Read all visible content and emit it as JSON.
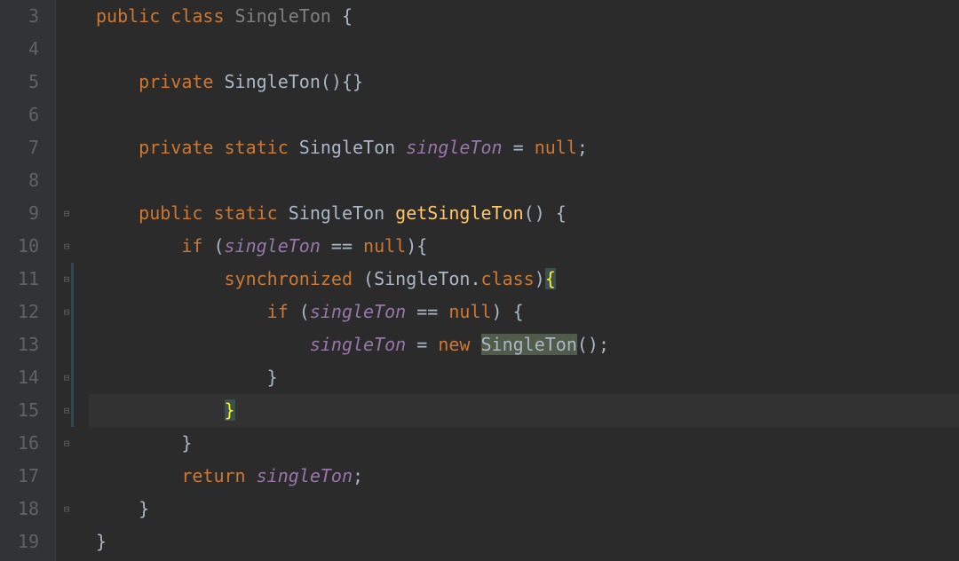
{
  "editor": {
    "startLine": 3,
    "lineNumbers": [
      "3",
      "4",
      "5",
      "6",
      "7",
      "8",
      "9",
      "10",
      "11",
      "12",
      "13",
      "14",
      "15",
      "16",
      "17",
      "18",
      "19"
    ],
    "currentLine": 15,
    "lines": [
      {
        "n": 3,
        "indent": 0,
        "fold": null,
        "tokens": [
          {
            "t": "public ",
            "c": "kw"
          },
          {
            "t": "class ",
            "c": "kw"
          },
          {
            "t": "SingleTon ",
            "c": "grey"
          },
          {
            "t": "{",
            "c": "punct"
          }
        ]
      },
      {
        "n": 4,
        "indent": 0,
        "fold": null,
        "tokens": []
      },
      {
        "n": 5,
        "indent": 1,
        "fold": null,
        "tokens": [
          {
            "t": "private ",
            "c": "kw"
          },
          {
            "t": "SingleTon",
            "c": "methoddecl"
          },
          {
            "t": "(){}",
            "c": "punct"
          }
        ]
      },
      {
        "n": 6,
        "indent": 0,
        "fold": null,
        "tokens": []
      },
      {
        "n": 7,
        "indent": 1,
        "fold": null,
        "tokens": [
          {
            "t": "private static ",
            "c": "kw"
          },
          {
            "t": "SingleTon ",
            "c": "punct"
          },
          {
            "t": "singleTon",
            "c": "field"
          },
          {
            "t": " = ",
            "c": "punct"
          },
          {
            "t": "null",
            "c": "kw"
          },
          {
            "t": ";",
            "c": "punct"
          }
        ]
      },
      {
        "n": 8,
        "indent": 0,
        "fold": null,
        "tokens": []
      },
      {
        "n": 9,
        "indent": 1,
        "fold": "open",
        "tokens": [
          {
            "t": "public static ",
            "c": "kw"
          },
          {
            "t": "SingleTon ",
            "c": "punct"
          },
          {
            "t": "getSingleTon",
            "c": "method"
          },
          {
            "t": "() {",
            "c": "punct"
          }
        ]
      },
      {
        "n": 10,
        "indent": 2,
        "fold": "open",
        "tokens": [
          {
            "t": "if ",
            "c": "kw"
          },
          {
            "t": "(",
            "c": "punct"
          },
          {
            "t": "singleTon",
            "c": "field"
          },
          {
            "t": " == ",
            "c": "punct"
          },
          {
            "t": "null",
            "c": "kw"
          },
          {
            "t": "){",
            "c": "punct"
          }
        ]
      },
      {
        "n": 11,
        "indent": 3,
        "fold": "open",
        "tokens": [
          {
            "t": "synchronized ",
            "c": "kw"
          },
          {
            "t": "(SingleTon.",
            "c": "punct"
          },
          {
            "t": "class",
            "c": "kw"
          },
          {
            "t": ")",
            "c": "punct"
          },
          {
            "t": "{",
            "c": "brace-match"
          }
        ]
      },
      {
        "n": 12,
        "indent": 4,
        "fold": "open",
        "tokens": [
          {
            "t": "if ",
            "c": "kw"
          },
          {
            "t": "(",
            "c": "punct"
          },
          {
            "t": "singleTon",
            "c": "field"
          },
          {
            "t": " == ",
            "c": "punct"
          },
          {
            "t": "null",
            "c": "kw"
          },
          {
            "t": ") {",
            "c": "punct"
          }
        ]
      },
      {
        "n": 13,
        "indent": 5,
        "fold": null,
        "tokens": [
          {
            "t": "singleTon",
            "c": "field"
          },
          {
            "t": " = ",
            "c": "punct"
          },
          {
            "t": "new ",
            "c": "kw"
          },
          {
            "t": "SingleTon",
            "c": "punct sel"
          },
          {
            "t": "();",
            "c": "punct"
          }
        ]
      },
      {
        "n": 14,
        "indent": 4,
        "fold": "close",
        "tokens": [
          {
            "t": "}",
            "c": "punct"
          }
        ]
      },
      {
        "n": 15,
        "indent": 3,
        "fold": "close",
        "current": true,
        "tokens": [
          {
            "t": "}",
            "c": "brace-match"
          }
        ]
      },
      {
        "n": 16,
        "indent": 2,
        "fold": "close",
        "tokens": [
          {
            "t": "}",
            "c": "punct"
          }
        ]
      },
      {
        "n": 17,
        "indent": 2,
        "fold": null,
        "tokens": [
          {
            "t": "return ",
            "c": "kw"
          },
          {
            "t": "singleTon",
            "c": "field"
          },
          {
            "t": ";",
            "c": "punct"
          }
        ]
      },
      {
        "n": 18,
        "indent": 1,
        "fold": "close",
        "tokens": [
          {
            "t": "}",
            "c": "punct"
          }
        ]
      },
      {
        "n": 19,
        "indent": 0,
        "fold": null,
        "tokens": [
          {
            "t": "}",
            "c": "punct"
          }
        ]
      }
    ],
    "changeMarker": {
      "from": 11,
      "to": 15
    }
  }
}
